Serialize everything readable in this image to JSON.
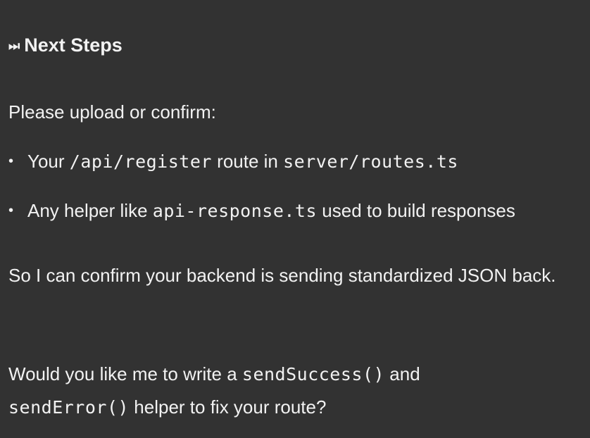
{
  "heading": {
    "icon": "next-track-icon",
    "glyph": "⏭",
    "text": "Next Steps"
  },
  "intro": "Please upload or confirm:",
  "bullets": [
    {
      "pre": "Your ",
      "code1": "/api/register",
      "mid": " route in ",
      "code2": "server/routes.ts",
      "post": ""
    },
    {
      "pre": "Any helper like ",
      "code1": "api-response.ts",
      "mid": " used to build responses",
      "code2": "",
      "post": ""
    }
  ],
  "paragraph1": "So I can confirm your backend is sending standardized JSON back.",
  "paragraph2": {
    "pre": "Would you like me to write a ",
    "code1": "sendSuccess()",
    "mid": " and ",
    "code2": "sendError()",
    "post": " helper to fix your route?"
  }
}
